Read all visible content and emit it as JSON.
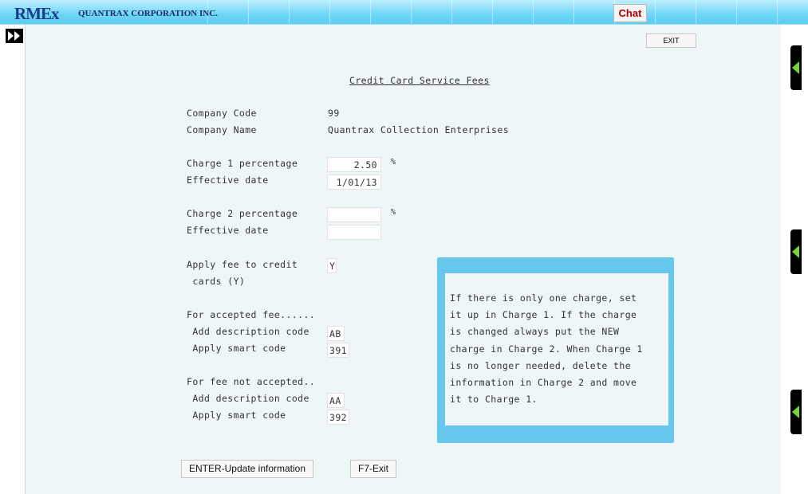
{
  "header": {
    "logo": "RMEx",
    "company": "QUANTRAX CORPORATION INC.",
    "chat_label": "Chat"
  },
  "toolbar": {
    "exit_label": "EXIT"
  },
  "form": {
    "title": "Credit Card Service Fees",
    "company_code_label": "Company Code",
    "company_code_value": "99",
    "company_name_label": "Company Name",
    "company_name_value": "Quantrax Collection Enterprises",
    "charge1_label": "Charge 1 percentage",
    "charge1_value": "2.50",
    "charge1_unit": "%",
    "effective1_label": "Effective date",
    "effective1_value": "1/01/13",
    "charge2_label": "Charge 2 percentage",
    "charge2_value": "",
    "charge2_unit": "%",
    "effective2_label": "Effective date",
    "effective2_value": "",
    "apply_fee_label_1": "Apply fee to credit",
    "apply_fee_label_2": " cards (Y)",
    "apply_fee_value": "Y",
    "accepted_heading": "For accepted fee......",
    "accepted_desc_label": " Add description code",
    "accepted_desc_value": "AB",
    "accepted_smart_label": " Apply smart code",
    "accepted_smart_value": "391",
    "not_accepted_heading": "For fee not accepted..",
    "not_accepted_desc_label": " Add description code",
    "not_accepted_desc_value": "AA",
    "not_accepted_smart_label": " Apply smart code",
    "not_accepted_smart_value": "392"
  },
  "help": {
    "lines": [
      "If there is only one charge, set",
      "it up in Charge 1. If the charge",
      "is changed always put the NEW",
      "charge in Charge 2. When Charge 1",
      "is no longer needed, delete the",
      "information in Charge 2 and move",
      "it to Charge 1."
    ]
  },
  "buttons": {
    "update_label": "ENTER-Update information",
    "exit_label": "F7-Exit"
  },
  "colors": {
    "header_blue": "#5ccdf0",
    "help_frame": "#67c8ee",
    "panel_bg": "#eef6f7",
    "side_tab": "#000000",
    "tab_arrow": "#7ad33a"
  }
}
